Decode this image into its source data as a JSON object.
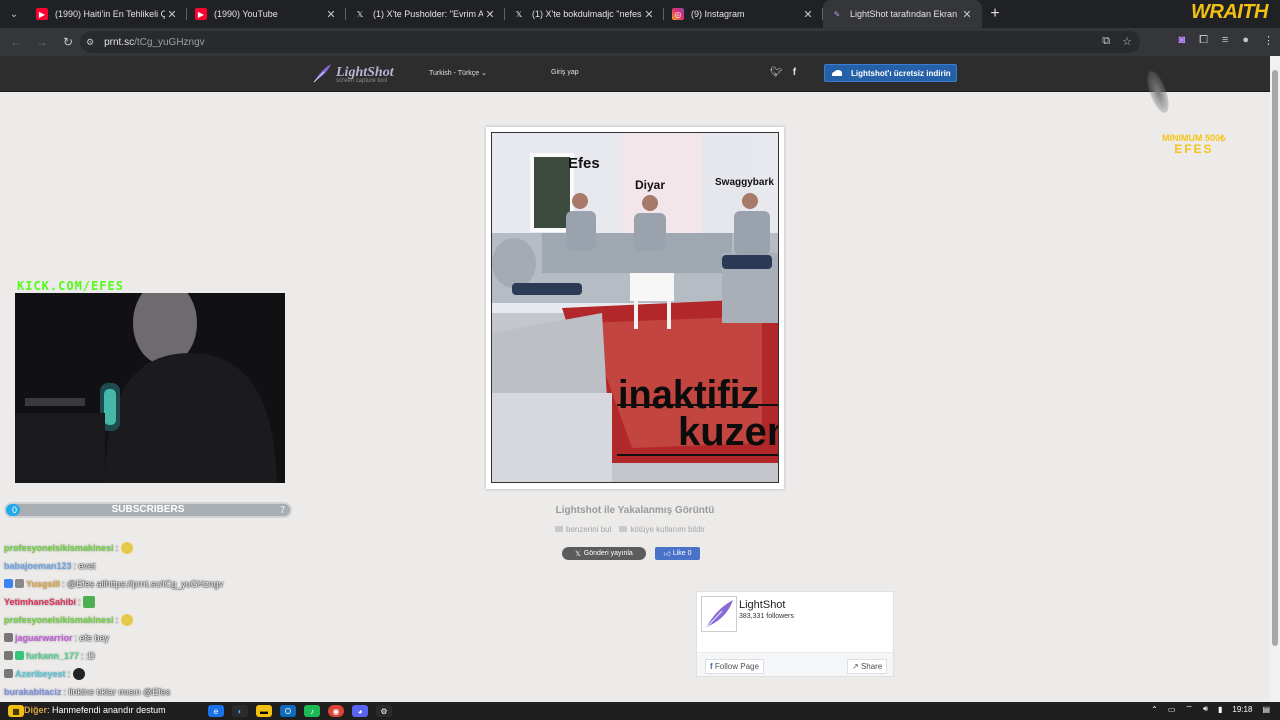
{
  "browser": {
    "tabs": [
      {
        "title": "(1990) Haiti'in En Tehlikeli Çete",
        "favicon": "youtube-icon",
        "color": "#ff0033"
      },
      {
        "title": "(1990) YouTube",
        "favicon": "youtube-icon",
        "color": "#ff0033"
      },
      {
        "title": "(1) X'te Pusholder: \"Evrim Akın,",
        "favicon": "x-icon",
        "color": "#000000"
      },
      {
        "title": "(1) X'te bokdulmadjc \"nefes kal",
        "favicon": "x-icon",
        "color": "#000000"
      },
      {
        "title": "(9) Instagram",
        "favicon": "instagram-icon",
        "color": "#e1306c"
      },
      {
        "title": "LightShot tarafından Ekran Gör",
        "favicon": "lightshot-icon",
        "color": "#8a6ad6"
      }
    ],
    "address": {
      "domain": "prnt.sc",
      "path": "/tCg_yuGHzngv"
    }
  },
  "overlay_brand": "WRAITH",
  "lightshot": {
    "logo": "LightShot",
    "tagline": "screen capture tool",
    "language": "Turkish - Türkçe",
    "login": "Giriş yap",
    "download_button": "Lightshot'ı ücretsiz indirin",
    "image_labels": {
      "names": [
        "Efes",
        "Diyar",
        "Swaggybark"
      ],
      "caption_line1": "inaktifiz",
      "caption_line2": "kuzen"
    },
    "caption": "Lightshot ile Yakalanmış Görüntü",
    "link_similar": "benzerini bul",
    "link_report": "kötüye kullanım bildir",
    "tweet_button": "Gönderi yayınla",
    "like_button": "Like 0",
    "facebook_page": {
      "name": "LightShot",
      "followers": "383,331 followers",
      "follow": "Follow Page",
      "share": "Share"
    }
  },
  "stream": {
    "channel": "KICK.COM/EFES",
    "subs": {
      "label": "SUBSCRIBERS",
      "current": "0",
      "goal": "7",
      "progress": 0
    },
    "donate": {
      "line1": "MINIMUM 500₺",
      "line2": "EFES"
    },
    "chat": [
      {
        "user": "profesyonelsikismakinesi",
        "text": ":",
        "color": "#6ed23c"
      },
      {
        "user": "babajoeman123",
        "text": ": evet",
        "color": "#6ca6e6"
      },
      {
        "user": "Yusgsill",
        "text": ": @Efes allhttps://prnt.sc/tCg_yuGHzngv",
        "color": "#d9a441"
      },
      {
        "user": "YetimhaneSahibi",
        "text": ":",
        "color": "#e0305a"
      },
      {
        "user": "profesyonelsikismakinesi",
        "text": ":",
        "color": "#6ed23c"
      },
      {
        "user": "jaguarwarrior",
        "text": ": efe bey",
        "color": "#c45ad9"
      },
      {
        "user": "furkann_177",
        "text": ": :D",
        "color": "#4fd18a"
      },
      {
        "user": "Azeribeyest",
        "text": ":",
        "color": "#53c6d8"
      },
      {
        "user": "burakabitaciz",
        "text": ": linkine tıklar mısın @Efes",
        "color": "#7b8fe6"
      },
      {
        "user": "Diğer",
        "text": ": Hanmefendi anandır destum",
        "color": "#d9a441"
      }
    ]
  },
  "taskbar": {
    "time": "19:18"
  }
}
